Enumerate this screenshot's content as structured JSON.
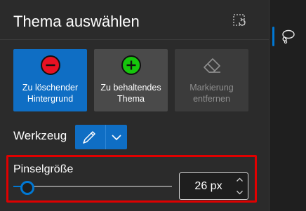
{
  "header": {
    "title": "Thema auswählen",
    "action_icon": "dashed-rotate-icon"
  },
  "tiles": [
    {
      "label": "Zu löschender Hintergrund",
      "icon": "minus-circle-icon",
      "color": "#e81123",
      "selected": true
    },
    {
      "label": "Zu behaltendes Thema",
      "icon": "plus-circle-icon",
      "color": "#16c60c",
      "selected": false
    },
    {
      "label": "Markierung entfernen",
      "icon": "eraser-icon",
      "selected": false,
      "disabled": true
    }
  ],
  "tool": {
    "label": "Werkzeug",
    "selected_icon": "pen-icon",
    "dropdown_icon": "chevron-down-icon"
  },
  "brush": {
    "label": "Pinselgröße",
    "value_text": "26 px",
    "slider_fraction": 0.0
  },
  "rail": {
    "icon": "paint-lasso-icon"
  },
  "colors": {
    "accent": "#0078d4",
    "highlight_border": "#e00000"
  }
}
